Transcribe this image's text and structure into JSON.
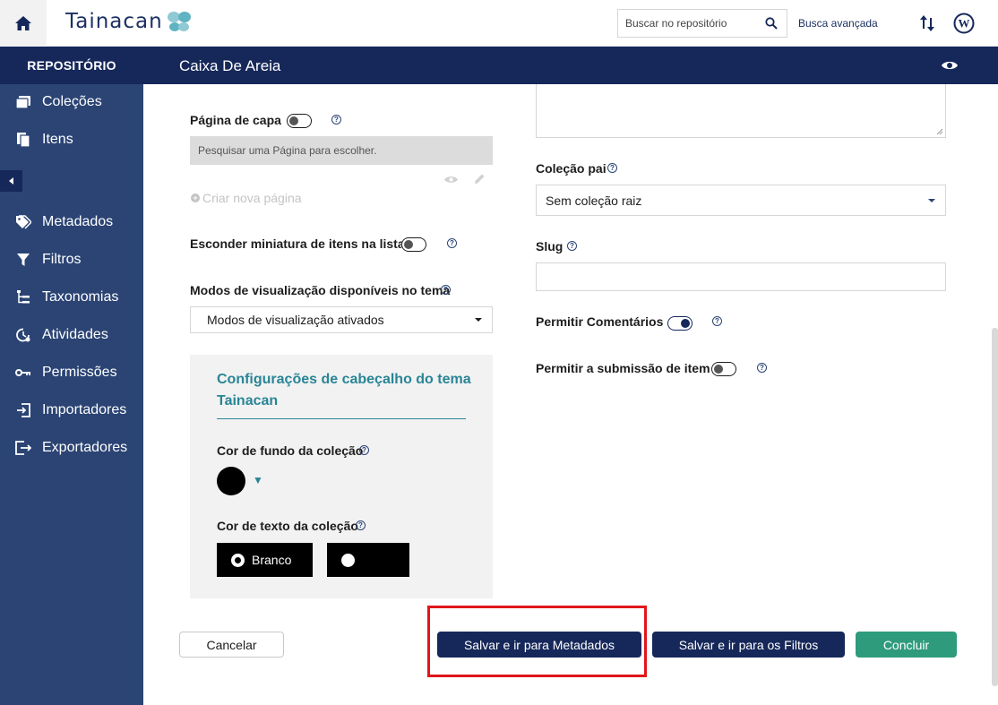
{
  "topbar": {
    "logo_text": "Tainacan",
    "search_placeholder": "Buscar no repositório",
    "advanced_search": "Busca avançada"
  },
  "header": {
    "repository": "REPOSITÓRIO",
    "page_title": "Caixa De Areia"
  },
  "sidebar": {
    "items": [
      {
        "label": "Coleções",
        "icon": "collections-icon"
      },
      {
        "label": "Itens",
        "icon": "items-icon"
      },
      {
        "label": "Metadados",
        "icon": "tag-icon"
      },
      {
        "label": "Filtros",
        "icon": "filter-icon"
      },
      {
        "label": "Taxonomias",
        "icon": "taxonomy-icon"
      },
      {
        "label": "Atividades",
        "icon": "activity-icon"
      },
      {
        "label": "Permissões",
        "icon": "key-icon"
      },
      {
        "label": "Importadores",
        "icon": "import-icon"
      },
      {
        "label": "Exportadores",
        "icon": "export-icon"
      }
    ]
  },
  "form": {
    "cover_page_label": "Página de capa",
    "cover_page_placeholder": "Pesquisar uma Página para escolher.",
    "create_page": "Criar nova página",
    "hide_thumbnail_label": "Esconder miniatura de itens na lista",
    "view_modes_label": "Modos de visualização disponíveis no tema",
    "view_modes_value": "Modos de visualização ativados",
    "header_settings_title": "Configurações de cabeçalho do tema Tainacan",
    "bg_color_label": "Cor de fundo da coleção",
    "text_color_label": "Cor de texto da coleção",
    "text_color_option_1": "Branco",
    "text_color_option_2": "",
    "parent_collection_label": "Coleção pai",
    "parent_collection_value": "Sem coleção raiz",
    "slug_label": "Slug",
    "allow_comments_label": "Permitir Comentários",
    "allow_submission_label": "Permitir a submissão de item",
    "help": "?",
    "toggles": {
      "cover_page": false,
      "hide_thumbnail": false,
      "allow_comments": true,
      "allow_submission": false
    }
  },
  "actions": {
    "cancel": "Cancelar",
    "save_metadata": "Salvar e ir para Metadados",
    "save_filters": "Salvar e ir para os Filtros",
    "finish": "Concluir"
  },
  "colors": {
    "header_band": "#16285a",
    "sidebar": "#2b4474",
    "accent_teal": "#298596",
    "finish_green": "#2e9b7c",
    "highlight_red": "#e0161b"
  }
}
